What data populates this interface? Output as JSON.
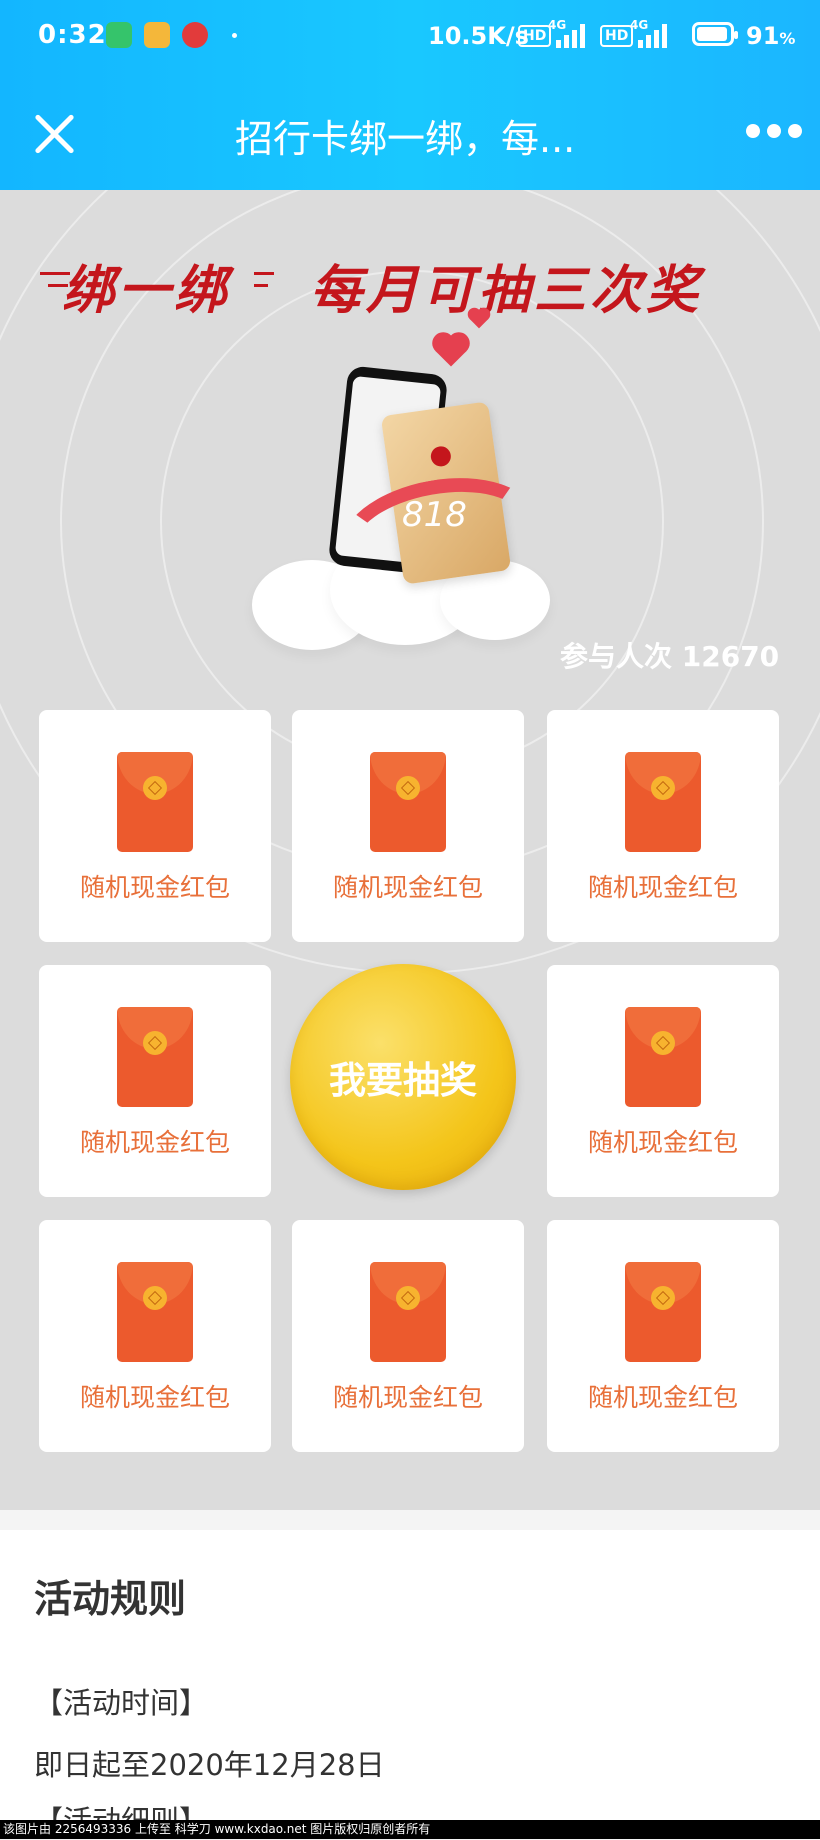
{
  "status_bar": {
    "time": "0:32",
    "network_speed": "10.5K/s",
    "hd_label": "HD",
    "network_type": "4G",
    "battery": "91",
    "battery_unit": "%"
  },
  "header": {
    "title": "招行卡绑一绑，每...",
    "close_icon": "close-icon",
    "more_icon": "more-icon"
  },
  "hero": {
    "headline_1": "绑一绑",
    "headline_2": "每月可抽三次奖",
    "badge_text": "818",
    "participants": "参与人次 12670"
  },
  "prizes": [
    {
      "label": "随机现金红包"
    },
    {
      "label": "随机现金红包"
    },
    {
      "label": "随机现金红包"
    },
    {
      "label": "随机现金红包"
    },
    {
      "label": "随机现金红包"
    },
    {
      "label": "随机现金红包"
    },
    {
      "label": "随机现金红包"
    },
    {
      "label": "随机现金红包"
    }
  ],
  "draw_button": "我要抽奖",
  "rules": {
    "title": "活动规则",
    "time_heading": "【活动时间】",
    "time_value": "即日起至2020年12月28日",
    "details_heading": "【活动细则】"
  },
  "footer": "该图片由 2256493336 上传至 科学刀 www.kxdao.net 图片版权归原创者所有",
  "colors": {
    "topbar": "#19c8ff",
    "headline": "#c4161c",
    "envelope": "#ec5a2d",
    "prize_text": "#e8703a",
    "draw_button": "#f4c51a"
  }
}
